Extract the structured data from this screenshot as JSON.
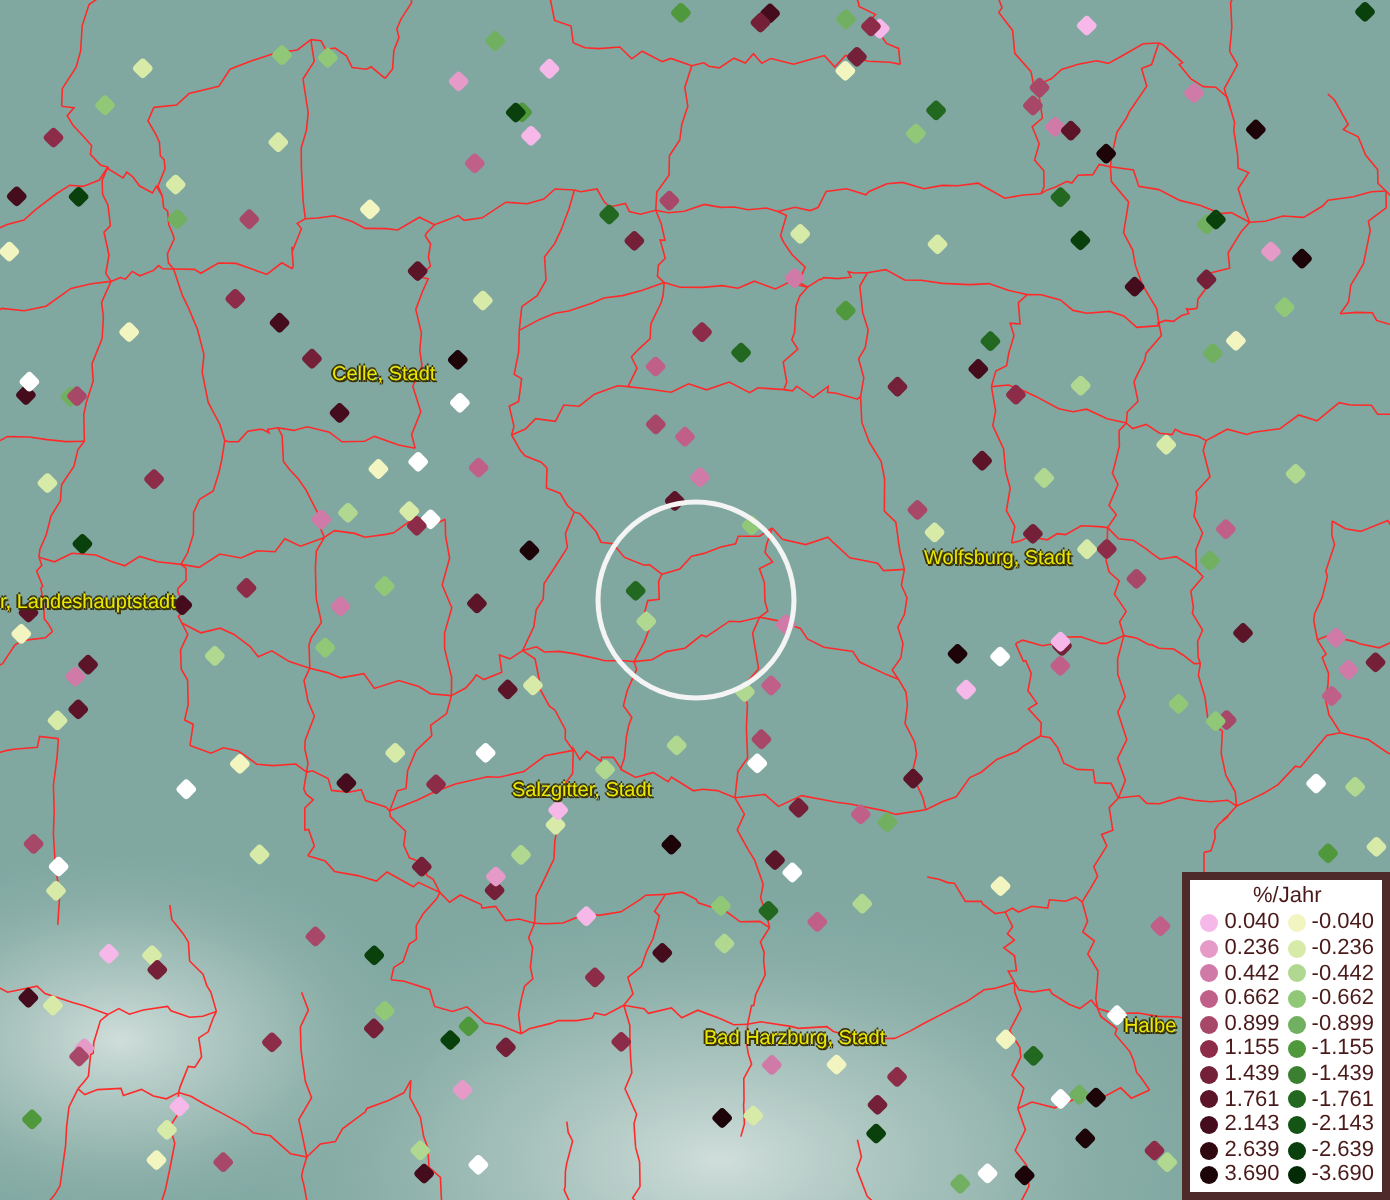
{
  "map": {
    "places": [
      {
        "name": "Celle, Stadt"
      },
      {
        "name": "r, Landeshauptstadt"
      },
      {
        "name": "Wolfsburg, Stadt"
      },
      {
        "name": "Salzgitter, Stadt"
      },
      {
        "name": "Bad Harzburg, Stadt"
      },
      {
        "name": "Halbe"
      }
    ]
  },
  "legend": {
    "title": "%/Jahr",
    "rows": [
      {
        "pos": {
          "value": "0.040",
          "color": "#f5b8e8"
        },
        "neg": {
          "value": "-0.040",
          "color": "#f2f5c0"
        }
      },
      {
        "pos": {
          "value": "0.236",
          "color": "#e59ac8"
        },
        "neg": {
          "value": "-0.236",
          "color": "#d8eaa8"
        }
      },
      {
        "pos": {
          "value": "0.442",
          "color": "#d07aa8"
        },
        "neg": {
          "value": "-0.442",
          "color": "#b0d890"
        }
      },
      {
        "pos": {
          "value": "0.662",
          "color": "#c06088"
        },
        "neg": {
          "value": "-0.662",
          "color": "#90c878"
        }
      },
      {
        "pos": {
          "value": "0.899",
          "color": "#a84868"
        },
        "neg": {
          "value": "-0.899",
          "color": "#70b060"
        }
      },
      {
        "pos": {
          "value": "1.155",
          "color": "#8c2c48"
        },
        "neg": {
          "value": "-1.155",
          "color": "#50983c"
        }
      },
      {
        "pos": {
          "value": "1.439",
          "color": "#742038"
        },
        "neg": {
          "value": "-1.439",
          "color": "#3a8030"
        }
      },
      {
        "pos": {
          "value": "1.761",
          "color": "#5c1428"
        },
        "neg": {
          "value": "-1.761",
          "color": "#226820"
        }
      },
      {
        "pos": {
          "value": "2.143",
          "color": "#440c1c"
        },
        "neg": {
          "value": "-2.143",
          "color": "#145414"
        }
      },
      {
        "pos": {
          "value": "2.639",
          "color": "#300810"
        },
        "neg": {
          "value": "-2.639",
          "color": "#0a400c"
        }
      },
      {
        "pos": {
          "value": "3.690",
          "color": "#1c0408"
        },
        "neg": {
          "value": "-3.690",
          "color": "#042a06"
        }
      }
    ]
  }
}
